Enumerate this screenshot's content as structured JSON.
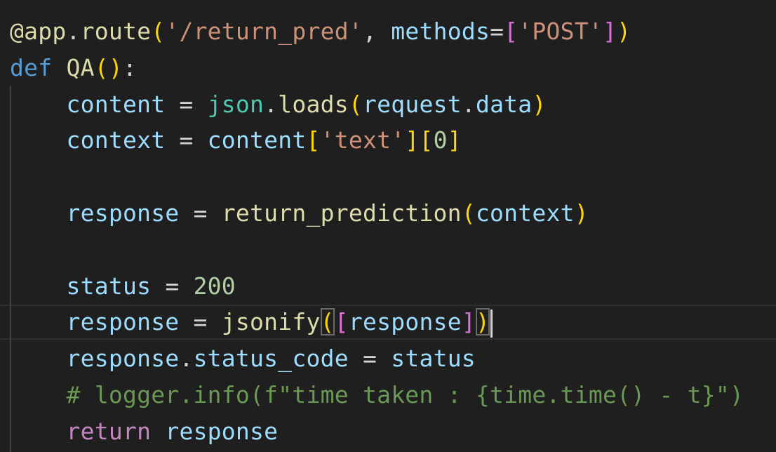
{
  "editor": {
    "lines": [
      {
        "tokens": [
          {
            "text": "@",
            "type": "func"
          },
          {
            "text": "app",
            "type": "func"
          },
          {
            "text": ".",
            "type": "plain"
          },
          {
            "text": "route",
            "type": "func"
          },
          {
            "text": "(",
            "type": "b1"
          },
          {
            "text": "'/return_pred'",
            "type": "string"
          },
          {
            "text": ", ",
            "type": "plain"
          },
          {
            "text": "methods",
            "type": "var"
          },
          {
            "text": "=",
            "type": "plain"
          },
          {
            "text": "[",
            "type": "b2"
          },
          {
            "text": "'POST'",
            "type": "string"
          },
          {
            "text": "]",
            "type": "b2"
          },
          {
            "text": ")",
            "type": "b1"
          }
        ]
      },
      {
        "tokens": [
          {
            "text": "def",
            "type": "keyword"
          },
          {
            "text": " ",
            "type": "plain"
          },
          {
            "text": "QA",
            "type": "func"
          },
          {
            "text": "()",
            "type": "b1"
          },
          {
            "text": ":",
            "type": "plain"
          }
        ]
      },
      {
        "tokens": [
          {
            "text": "    ",
            "type": "plain"
          },
          {
            "text": "content",
            "type": "var"
          },
          {
            "text": " = ",
            "type": "plain"
          },
          {
            "text": "json",
            "type": "class"
          },
          {
            "text": ".",
            "type": "plain"
          },
          {
            "text": "loads",
            "type": "func"
          },
          {
            "text": "(",
            "type": "b1"
          },
          {
            "text": "request",
            "type": "var"
          },
          {
            "text": ".",
            "type": "plain"
          },
          {
            "text": "data",
            "type": "var"
          },
          {
            "text": ")",
            "type": "b1"
          }
        ]
      },
      {
        "tokens": [
          {
            "text": "    ",
            "type": "plain"
          },
          {
            "text": "context",
            "type": "var"
          },
          {
            "text": " = ",
            "type": "plain"
          },
          {
            "text": "content",
            "type": "var"
          },
          {
            "text": "[",
            "type": "b1"
          },
          {
            "text": "'text'",
            "type": "string"
          },
          {
            "text": "]",
            "type": "b1"
          },
          {
            "text": "[",
            "type": "b1"
          },
          {
            "text": "0",
            "type": "number"
          },
          {
            "text": "]",
            "type": "b1"
          }
        ]
      },
      {
        "tokens": []
      },
      {
        "tokens": [
          {
            "text": "    ",
            "type": "plain"
          },
          {
            "text": "response",
            "type": "var"
          },
          {
            "text": " = ",
            "type": "plain"
          },
          {
            "text": "return_prediction",
            "type": "func"
          },
          {
            "text": "(",
            "type": "b1"
          },
          {
            "text": "context",
            "type": "var"
          },
          {
            "text": ")",
            "type": "b1"
          }
        ]
      },
      {
        "tokens": []
      },
      {
        "tokens": [
          {
            "text": "    ",
            "type": "plain"
          },
          {
            "text": "status",
            "type": "var"
          },
          {
            "text": " = ",
            "type": "plain"
          },
          {
            "text": "200",
            "type": "number"
          }
        ]
      },
      {
        "tokens": [
          {
            "text": "    ",
            "type": "plain"
          },
          {
            "text": "response",
            "type": "var"
          },
          {
            "text": " = ",
            "type": "plain"
          },
          {
            "text": "jsonify",
            "type": "func"
          },
          {
            "text": "(",
            "type": "b1",
            "match": true
          },
          {
            "text": "[",
            "type": "b2"
          },
          {
            "text": "response",
            "type": "var"
          },
          {
            "text": "]",
            "type": "b2"
          },
          {
            "text": ")",
            "type": "b1",
            "match": true
          },
          {
            "text": "",
            "type": "cursor"
          }
        ]
      },
      {
        "tokens": [
          {
            "text": "    ",
            "type": "plain"
          },
          {
            "text": "response",
            "type": "var"
          },
          {
            "text": ".",
            "type": "plain"
          },
          {
            "text": "status_code",
            "type": "var"
          },
          {
            "text": " = ",
            "type": "plain"
          },
          {
            "text": "status",
            "type": "var"
          }
        ]
      },
      {
        "tokens": [
          {
            "text": "    ",
            "type": "plain"
          },
          {
            "text": "# logger.info(f\"time taken : {time.time() - t}\")",
            "type": "comment"
          }
        ]
      },
      {
        "tokens": [
          {
            "text": "    ",
            "type": "plain"
          },
          {
            "text": "return",
            "type": "ctrl"
          },
          {
            "text": " ",
            "type": "plain"
          },
          {
            "text": "response",
            "type": "var"
          }
        ]
      }
    ]
  }
}
